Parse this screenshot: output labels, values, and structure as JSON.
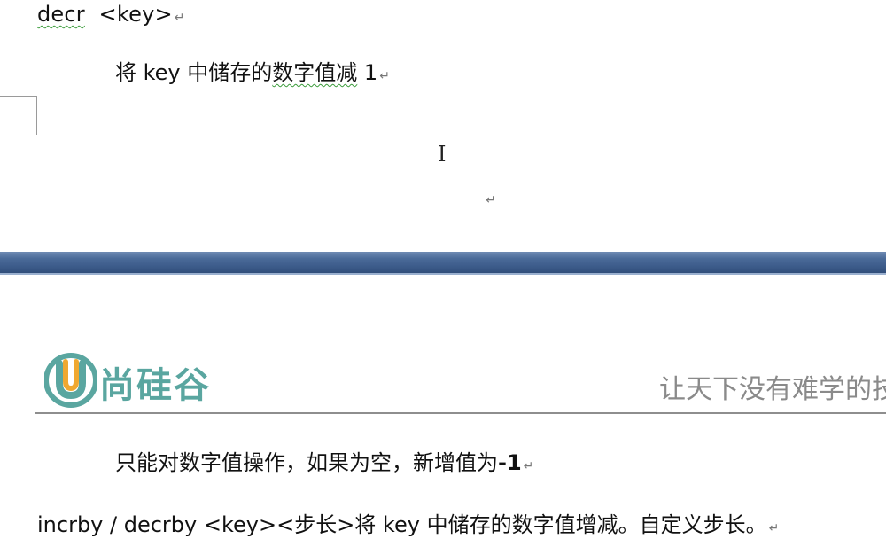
{
  "top_page": {
    "command": "decr",
    "command_arg": "<key>",
    "description_prefix": "将 key 中储存的",
    "description_squiggle": "数字值减",
    "description_suffix": " 1",
    "paragraph_mark": "↵",
    "cursor_glyph": "I"
  },
  "header": {
    "logo_text": "尚硅谷",
    "slogan": "让天下没有难学的技"
  },
  "bottom_page": {
    "note_prefix": "只能对数字值操作，如果为空，新增值为",
    "note_value": "-1",
    "command2": "incrby / decrby  <key><步长>将 key 中储存的数字值增减。自定义步长。",
    "paragraph_mark": "↵"
  },
  "colors": {
    "separator": "#3e5d8c",
    "logo_teal": "#5aa6a0",
    "logo_orange": "#f0a830",
    "squiggle": "#3a9b3a"
  }
}
